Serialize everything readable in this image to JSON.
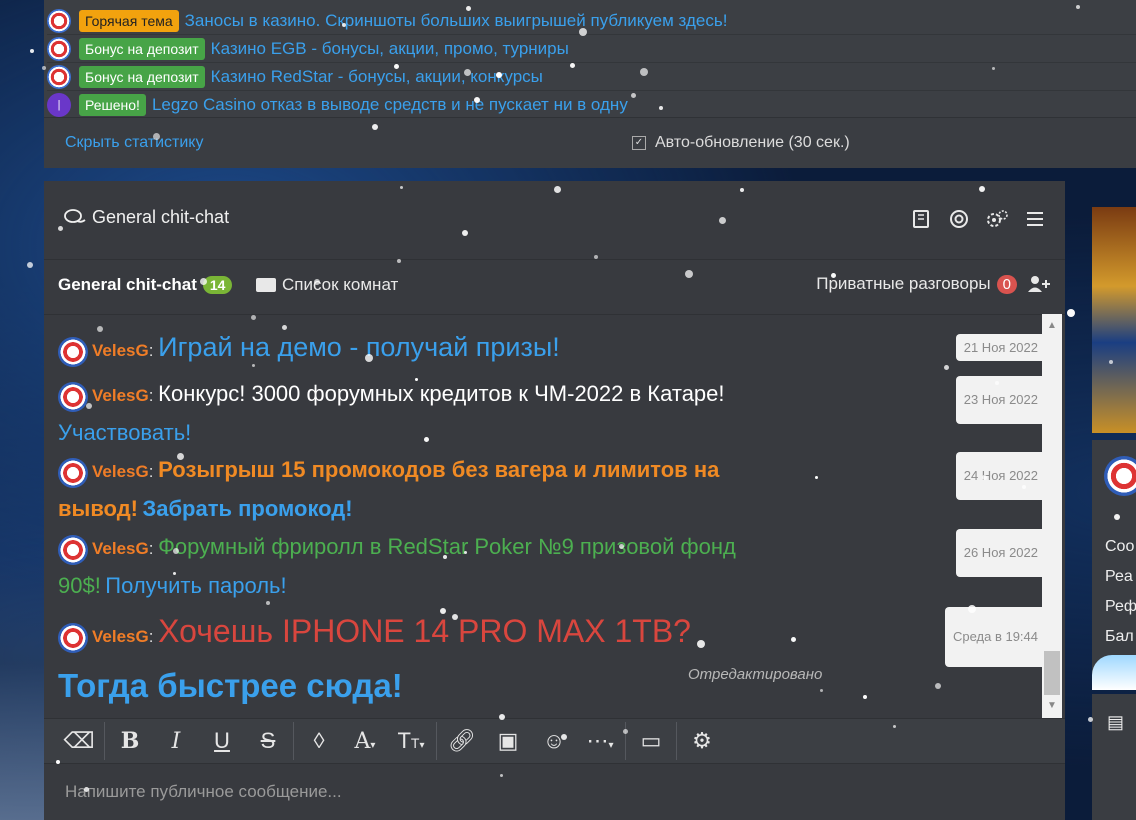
{
  "threads": [
    {
      "tag": "Горячая тема",
      "tag_style": "hot",
      "title": "Заносы в казино. Скриншоты больших выигрышей публикуем здесь!",
      "avatar": "gear-avatar"
    },
    {
      "tag": "Бонус на депозит",
      "tag_style": "green",
      "title": "Казино EGB - бонусы, акции, промо, турниры",
      "avatar": "casino-logo-avatar"
    },
    {
      "tag": "Бонус на депозит",
      "tag_style": "green",
      "title": "Казино RedStar - бонусы, акции, конкурсы",
      "avatar": "casino-logo-avatar"
    },
    {
      "tag": "Решено!",
      "tag_style": "green",
      "title": "Legzo Casino отказ в выводе средств и не пускает ни в одну",
      "avatar": "legzo-avatar"
    }
  ],
  "stats_footer": {
    "hide_link": "Скрыть статистику",
    "auto_update": "Авто-обновление (30 сек.)",
    "auto_update_checked": true
  },
  "chat": {
    "title": "General chit-chat",
    "room_name": "General chit-chat",
    "room_count": "14",
    "room_list": "Список комнат",
    "private_label": "Приватные разговоры",
    "private_count": "0",
    "header_icons": [
      "rules-book-icon",
      "help-lifebuoy-icon",
      "settings-gears-icon",
      "menu-icon"
    ],
    "messages": [
      {
        "user": "VelesG",
        "date": "21 Ноя 2022",
        "parts": [
          {
            "text": "Играй на демо - получай призы!",
            "style": "blue"
          }
        ]
      },
      {
        "user": "VelesG",
        "date": "23 Ноя 2022",
        "parts": [
          {
            "text": "Конкурс! 3000 форумных кредитов к ЧМ-2022 в Катаре!",
            "style": "white"
          },
          {
            "text": "Участвовать!",
            "style": "blue"
          }
        ]
      },
      {
        "user": "VelesG",
        "date": "24 Ноя 2022",
        "parts": [
          {
            "text": "Розыгрыш 15 промокодов без вагера и лимитов на",
            "style": "orange"
          },
          {
            "text": "вывод!",
            "style": "orange"
          },
          {
            "text": "Забрать промокод!",
            "style": "blue"
          }
        ]
      },
      {
        "user": "VelesG",
        "date": "26 Ноя 2022",
        "parts": [
          {
            "text": "Форумный фриролл в RedStar Poker №9 призовой фонд",
            "style": "green"
          },
          {
            "text": "90$!",
            "style": "green"
          },
          {
            "text": "Получить пароль!",
            "style": "blue"
          }
        ]
      },
      {
        "user": "VelesG",
        "date": "Среда в 19:44",
        "parts": [
          {
            "text": "Хочешь IPHONE 14 PRO MAX 1TB?",
            "style": "red"
          },
          {
            "text": "Тогда быстрее сюда!",
            "style": "blue"
          }
        ],
        "edited": "Отредактировано"
      }
    ],
    "toolbar": [
      "eraser-icon",
      "bold-icon",
      "italic-icon",
      "underline-icon",
      "strikethrough-icon",
      "color-drop-icon",
      "font-family-icon",
      "font-size-icon",
      "link-icon",
      "image-icon",
      "emoji-icon",
      "more-icon",
      "spoiler-money-icon",
      "settings-icon"
    ],
    "input_placeholder": "Напишите публичное сообщение..."
  },
  "right_sidebar": {
    "items": [
      "Соо",
      "Реа",
      "Реф",
      "Бал"
    ]
  }
}
